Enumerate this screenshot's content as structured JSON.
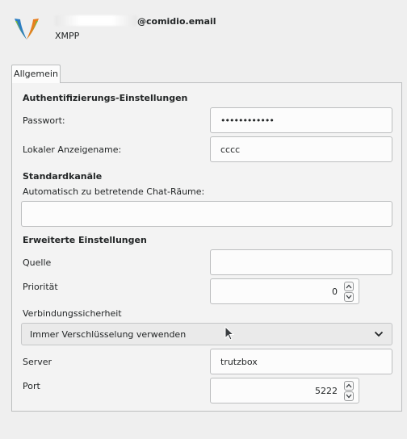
{
  "header": {
    "account_suffix": "@comidio.email",
    "protocol": "XMPP"
  },
  "tabs": [
    {
      "label": "Allgemein"
    }
  ],
  "auth": {
    "section_title": "Authentifizierungs-Einstellungen",
    "password_label": "Passwort:",
    "password_value": "••••••••••••",
    "display_name_label": "Lokaler Anzeigename:",
    "display_name_value": "cccc"
  },
  "channels": {
    "section_title": "Standardkanäle",
    "autojoin_label": "Automatisch zu betretende Chat-Räume:",
    "autojoin_value": ""
  },
  "advanced": {
    "section_title": "Erweiterte Einstellungen",
    "source_label": "Quelle",
    "source_value": "",
    "priority_label": "Priorität",
    "priority_value": "0",
    "security_label": "Verbindungssicherheit",
    "security_value": "Immer Verschlüsselung verwenden",
    "server_label": "Server",
    "server_value": "trutzbox",
    "port_label": "Port",
    "port_value": "5222"
  },
  "icons": {
    "logo": "xmpp-logo-icon",
    "spin_up": "arrow-up-icon",
    "spin_down": "arrow-down-icon",
    "combo_open": "chevron-down-icon",
    "cursor": "mouse-pointer-icon"
  },
  "colors": {
    "background": "#efefef",
    "field": "#fcfcfc",
    "border": "#bcbebf",
    "logo_green": "#7cba3a",
    "logo_orange": "#e87e1e",
    "logo_blue": "#2b7dc2"
  }
}
